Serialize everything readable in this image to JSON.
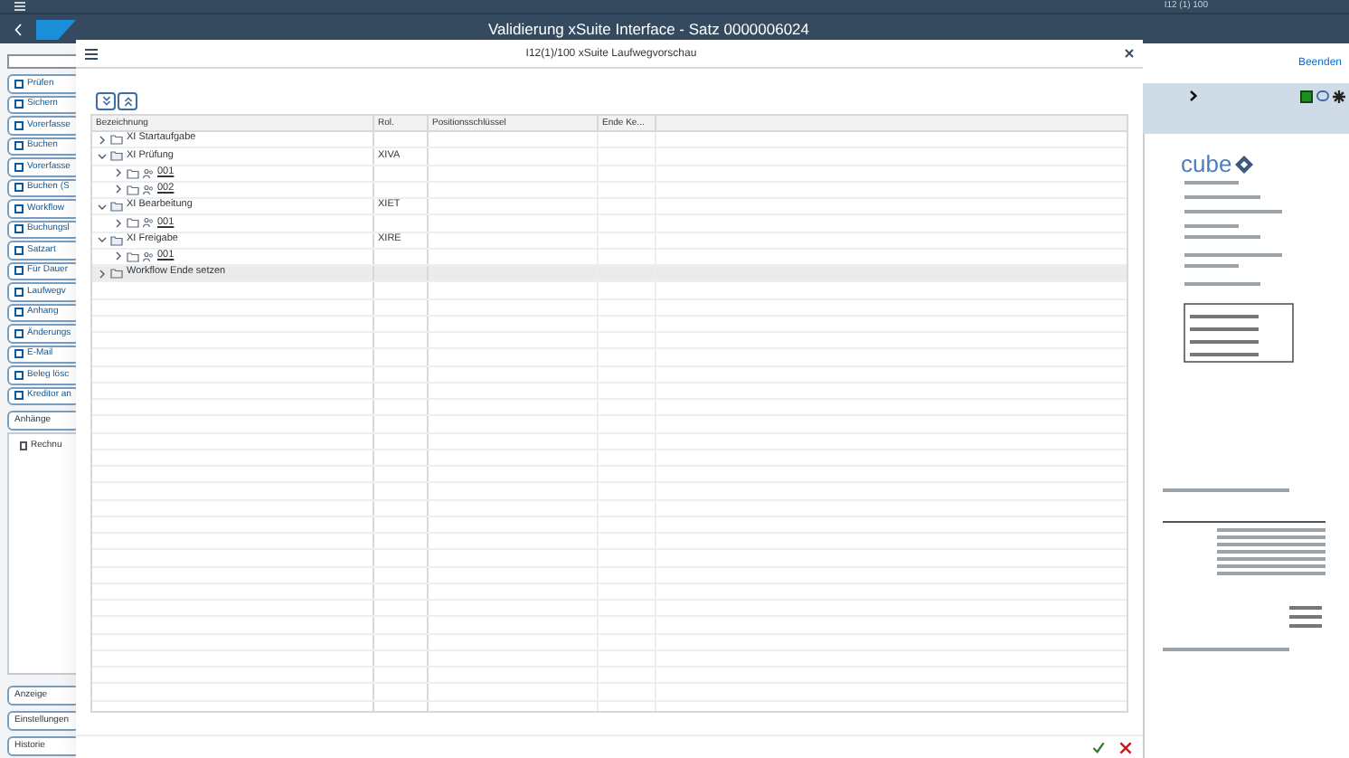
{
  "top_bar": {
    "session": "I12 (1) 100"
  },
  "title_bar": {
    "title": "Validierung xSuite Interface - Satz 0000006024"
  },
  "sidebar": {
    "buttons": [
      {
        "label": "Prüfen"
      },
      {
        "label": "Sichern"
      },
      {
        "label": "Vorerfasse"
      },
      {
        "label": "Buchen"
      },
      {
        "label": "Vorerfasse"
      },
      {
        "label": "Buchen (S"
      },
      {
        "label": "Workflow"
      },
      {
        "label": "Buchungsl"
      },
      {
        "label": "Satzart"
      },
      {
        "label": "Für Dauer"
      },
      {
        "label": "Laufwegv"
      },
      {
        "label": "Anhang"
      },
      {
        "label": "Änderungs"
      },
      {
        "label": "E-Mail"
      },
      {
        "label": "Beleg lösc"
      },
      {
        "label": "Kreditor an"
      }
    ],
    "attachments_tab": "Anhänge",
    "attachments": [
      "Rechnu"
    ],
    "bottom_buttons": [
      "Anzeige",
      "Einstellungen",
      "Historie"
    ]
  },
  "dialog": {
    "title": "I12(1)/100 xSuite Laufwegvorschau",
    "table": {
      "columns": [
        "Bezeichnung",
        "Rol.",
        "Positionsschlüssel",
        "Ende Ke..."
      ],
      "rows": [
        {
          "label": "XI Startaufgabe",
          "expanded": false,
          "selected": false,
          "kind": "step",
          "children": []
        },
        {
          "label": "XI Prüfung",
          "rol": "XIVA",
          "expanded": true,
          "selected": false,
          "kind": "step",
          "children": [
            {
              "label": "001",
              "expanded": false,
              "selected": false,
              "kind": "agent"
            },
            {
              "label": "002",
              "expanded": false,
              "selected": false,
              "kind": "agent"
            }
          ]
        },
        {
          "label": "XI Bearbeitung",
          "rol": "XIET",
          "expanded": true,
          "selected": false,
          "kind": "step",
          "children": [
            {
              "label": "001",
              "expanded": false,
              "selected": false,
              "kind": "agent"
            }
          ]
        },
        {
          "label": "XI Freigabe",
          "rol": "XIRE",
          "expanded": true,
          "selected": false,
          "kind": "step",
          "children": [
            {
              "label": "001",
              "expanded": false,
              "selected": false,
              "kind": "agent"
            }
          ]
        },
        {
          "label": "Workflow Ende setzen",
          "expanded": false,
          "selected": true,
          "kind": "step",
          "children": []
        }
      ]
    }
  },
  "right_panel": {
    "exit_link": "Beenden",
    "logo_text": "cube"
  }
}
